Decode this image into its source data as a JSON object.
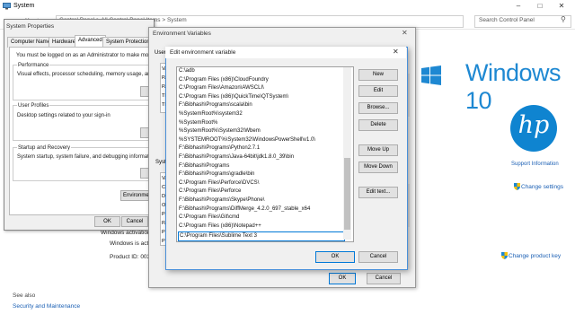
{
  "system_window": {
    "title": "System",
    "address": "Control Panel  >  All Control Panel Items  >  System",
    "search_placeholder": "Search Control Panel",
    "windows_brand": "Windows 10",
    "hp_logo": "hp",
    "support_information": "Support Information",
    "change_settings": "Change settings",
    "windows_activation": "Windows activation",
    "windows_is_activated": "Windows is activ",
    "product_id": "Product ID: 003",
    "see_also": "See also",
    "security_and_maintenance": "Security and Maintenance",
    "change_product_key": "Change product key",
    "accent_color": "#1e88d2"
  },
  "system_properties": {
    "title": "System Properties",
    "tabs": [
      "Computer Name",
      "Hardware",
      "Advanced",
      "System Protection"
    ],
    "active_tab": "Advanced",
    "admin_note": "You must be logged on as an Administrator to make most of th",
    "performance_title": "Performance",
    "performance_desc": "Visual effects, processor scheduling, memory usage, and virt",
    "user_profiles_title": "User Profiles",
    "user_profiles_desc": "Desktop settings related to your sign-in",
    "startup_title": "Startup and Recovery",
    "startup_desc": "System startup, system failure, and debugging information",
    "env_button": "Environment",
    "ok": "OK",
    "cancel": "Cancel"
  },
  "environment_variables": {
    "title": "Environment Variables",
    "user_label": "User",
    "system_label": "Syste",
    "user_row_stubs": [
      "Var",
      "PA",
      "PA",
      "TE",
      "TM"
    ],
    "system_row_stubs": [
      "Var",
      "Co",
      "Dr",
      "OS",
      "Pa",
      "PA",
      "PR",
      "PR"
    ],
    "ok": "OK",
    "cancel": "Cancel"
  },
  "edit_variable": {
    "title": "Edit environment variable",
    "paths": [
      "C:\\adb",
      "C:\\Program Files (x86)\\CloudFoundry",
      "C:\\Program Files\\Amazon\\AWSCLI\\",
      "C:\\Program Files (x86)\\QuickTime\\QTSystem\\",
      "F:\\Bibhash\\Programs\\scala\\bin",
      "%SystemRoot%\\system32",
      "%SystemRoot%",
      "%SystemRoot%\\System32\\Wbem",
      "%SYSTEMROOT%\\System32\\WindowsPowerShell\\v1.0\\",
      "F:\\Bibhash\\Programs\\Python2.7.1",
      "F:\\Bibhash\\Programs\\Java-64bit\\jdk1.8.0_39\\bin",
      "F:\\Bibhash\\Programs",
      "F:\\Bibhash\\Programs\\gradle\\bin",
      "C:\\Program Files\\Perforce\\DVCS\\",
      "C:\\Program Files\\Perforce",
      "F:\\Bibhash\\Programs\\Skype\\Phone\\",
      "F:\\Bibhash\\Programs\\DiffMerge_4.2.0_697_stable_x64",
      "C:\\Program Files\\Git\\cmd",
      "C:\\Program Files (x86)\\Notepad++"
    ],
    "editing_value": "C:\\Program Files\\Sublime Text 3",
    "buttons": {
      "new": "New",
      "edit": "Edit",
      "browse": "Browse...",
      "delete": "Delete",
      "move_up": "Move Up",
      "move_down": "Move Down",
      "edit_text": "Edit text..."
    },
    "ok": "OK",
    "cancel": "Cancel"
  }
}
